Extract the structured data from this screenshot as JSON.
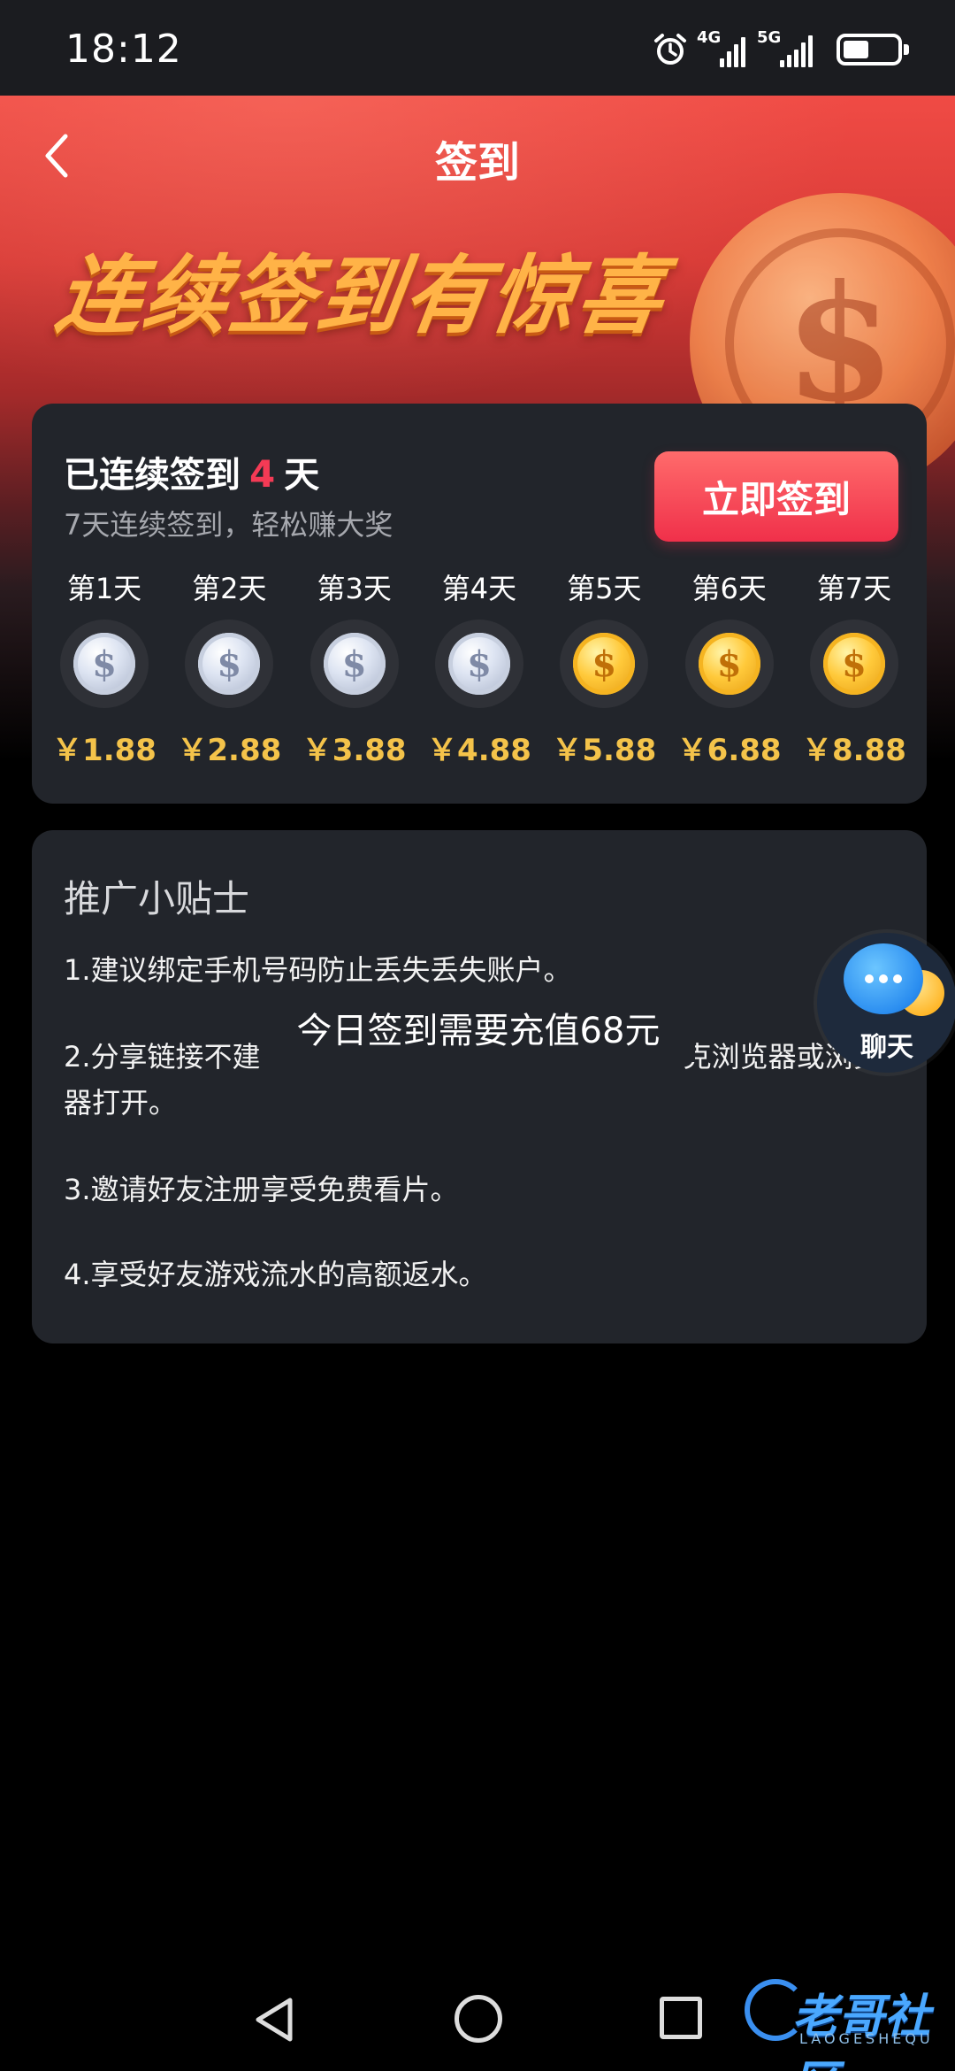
{
  "status_bar": {
    "time": "18:12",
    "signal_1": "4G",
    "signal_2": "5G"
  },
  "header": {
    "title": "签到",
    "banner_text": "连续签到有惊喜"
  },
  "signin": {
    "streak_prefix": "已连续签到",
    "streak_days": "4",
    "streak_suffix": "天",
    "subtitle": "7天连续签到，轻松赚大奖",
    "button_label": "立即签到",
    "days": [
      {
        "label": "第1天",
        "amount": "￥1.88",
        "coin": "silver"
      },
      {
        "label": "第2天",
        "amount": "￥2.88",
        "coin": "silver"
      },
      {
        "label": "第3天",
        "amount": "￥3.88",
        "coin": "silver"
      },
      {
        "label": "第4天",
        "amount": "￥4.88",
        "coin": "silver"
      },
      {
        "label": "第5天",
        "amount": "￥5.88",
        "coin": "gold"
      },
      {
        "label": "第6天",
        "amount": "￥6.88",
        "coin": "gold"
      },
      {
        "label": "第7天",
        "amount": "￥8.88",
        "coin": "gold"
      }
    ]
  },
  "tips": {
    "title": "推广小贴士",
    "items": [
      "1.建议绑定手机号码防止丢失丢失账户。",
      "2.分享链接不建                                               克浏览器或浏览器打开。",
      "3.邀请好友注册享受免费看片。",
      "4.享受好友游戏流水的高额返水。"
    ]
  },
  "overlay": {
    "message": "今日签到需要充值68元"
  },
  "chat": {
    "label": "聊天"
  },
  "watermark": {
    "text": "老哥社区",
    "sub": "LAOGESHEQU"
  },
  "colors": {
    "accent_red": "#f43a55",
    "gold_amount": "#f4c34a",
    "card_bg": "#22252b"
  }
}
